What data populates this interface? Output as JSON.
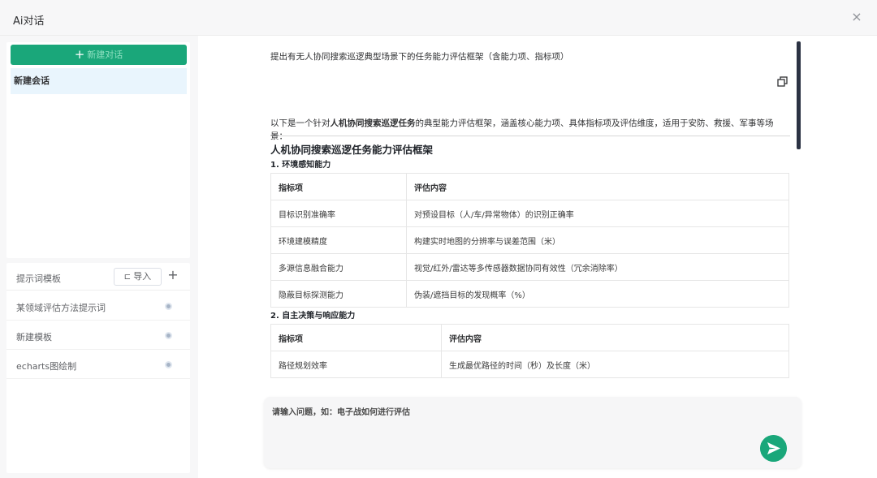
{
  "window": {
    "title": "Ai对话",
    "close": "×"
  },
  "sidebar": {
    "new_chat_label": "新建对话",
    "conversations": [
      {
        "label": "新建会话"
      }
    ]
  },
  "templates": {
    "header_label": "提示词模板",
    "import_label": "导入",
    "items": [
      {
        "label": "某领域评估方法提示词"
      },
      {
        "label": "新建模板"
      },
      {
        "label": "echarts图绘制"
      }
    ]
  },
  "chat": {
    "user_message": "提出有无人协同搜索巡逻典型场景下的任务能力评估框架（含能力项、指标项）",
    "answer": {
      "intro_prefix": "以下是一个针对",
      "intro_bold": "人机协同搜索巡逻任务",
      "intro_suffix": "的典型能力评估框架，涵盖核心能力项、具体指标项及评估维度，适用于安防、救援、军事等场景：",
      "title": "人机协同搜索巡逻任务能力评估框架",
      "sections": [
        {
          "heading": "1. 环境感知能力",
          "columns": [
            "指标项",
            "评估内容"
          ],
          "rows": [
            [
              "目标识别准确率",
              "对预设目标（人/车/异常物体）的识别正确率"
            ],
            [
              "环境建模精度",
              "构建实时地图的分辨率与误差范围（米）"
            ],
            [
              "多源信息融合能力",
              "视觉/红外/雷达等多传感器数据协同有效性（冗余消除率）"
            ],
            [
              "隐蔽目标探测能力",
              "伪装/遮挡目标的发现概率（%）"
            ]
          ]
        },
        {
          "heading": "2. 自主决策与响应能力",
          "columns": [
            "指标项",
            "评估内容"
          ],
          "rows": [
            [
              "路径规划效率",
              "生成最优路径的时间（秒）及长度（米）"
            ]
          ]
        }
      ]
    }
  },
  "input": {
    "placeholder": "请输入问题，如：电子战如何进行评估"
  }
}
